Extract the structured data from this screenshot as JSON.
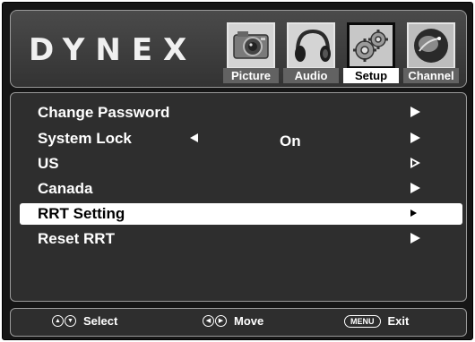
{
  "brand": "DYNEX",
  "tabs": [
    {
      "label": "Picture",
      "icon": "camera-icon"
    },
    {
      "label": "Audio",
      "icon": "headphones-icon"
    },
    {
      "label": "Setup",
      "icon": "gear-icon",
      "active": true
    },
    {
      "label": "Channel",
      "icon": "satellite-dish-icon"
    }
  ],
  "menu": [
    {
      "label": "Change Password"
    },
    {
      "label": "System Lock",
      "value": "On"
    },
    {
      "label": "US"
    },
    {
      "label": "Canada"
    },
    {
      "label": "RRT Setting",
      "selected": true
    },
    {
      "label": "Reset RRT"
    }
  ],
  "footer": {
    "select_label": "Select",
    "move_label": "Move",
    "menu_key": "MENU",
    "exit_label": "Exit"
  },
  "colors": {
    "background": "#161616",
    "panel": "#2e2e2e",
    "highlight": "#ffffff",
    "text": "#ffffff"
  }
}
